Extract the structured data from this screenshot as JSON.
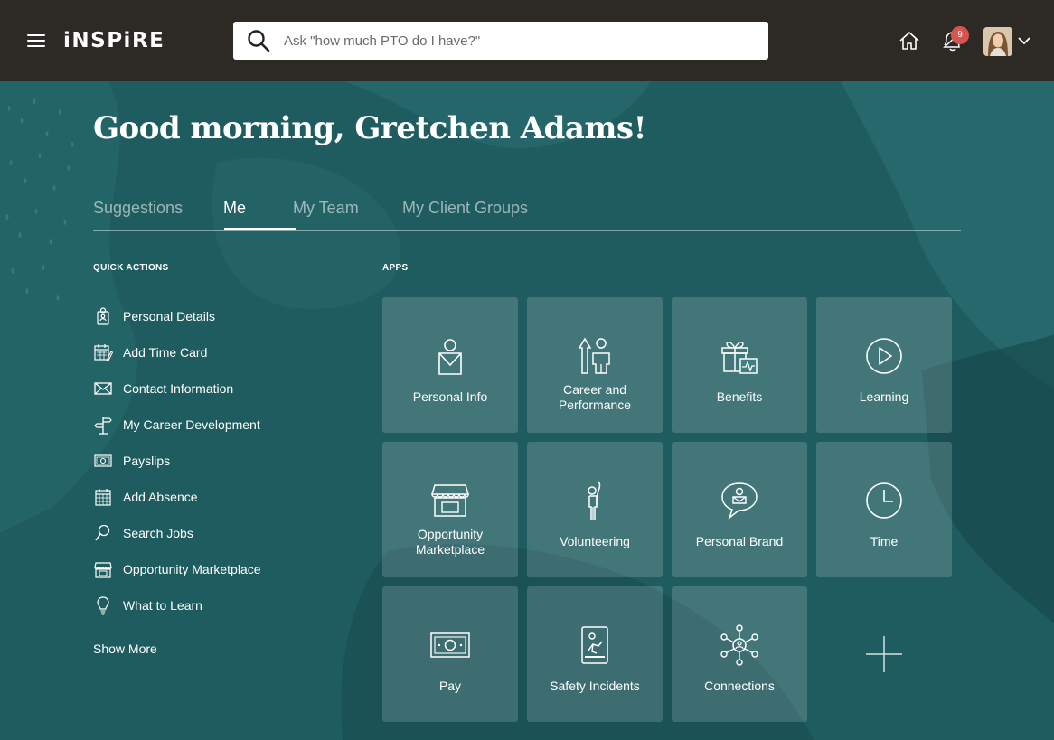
{
  "header": {
    "logo_text": "iNSPiRE",
    "search_placeholder": "Ask \"how much PTO do I have?\"",
    "notification_count": "9",
    "icons": [
      "menu-icon",
      "search-icon",
      "home-icon",
      "notifications-icon",
      "chevron-down-icon"
    ]
  },
  "greeting": "Good morning, Gretchen Adams!",
  "tabs": [
    {
      "label": "Suggestions",
      "active": false
    },
    {
      "label": "Me",
      "active": true
    },
    {
      "label": "My Team",
      "active": false
    },
    {
      "label": "My Client Groups",
      "active": false
    }
  ],
  "quick_actions": {
    "heading": "QUICK ACTIONS",
    "items": [
      {
        "label": "Personal Details",
        "icon": "person-badge-icon"
      },
      {
        "label": "Add Time Card",
        "icon": "time-card-icon"
      },
      {
        "label": "Contact Information",
        "icon": "envelope-icon"
      },
      {
        "label": "My Career Development",
        "icon": "signpost-icon"
      },
      {
        "label": "Payslips",
        "icon": "money-icon"
      },
      {
        "label": "Add Absence",
        "icon": "calendar-icon"
      },
      {
        "label": "Search Jobs",
        "icon": "search-icon"
      },
      {
        "label": "Opportunity Marketplace",
        "icon": "storefront-icon"
      },
      {
        "label": "What to Learn",
        "icon": "lightbulb-icon"
      }
    ],
    "show_more": "Show More"
  },
  "apps": {
    "heading": "APPS",
    "tiles": [
      {
        "label": "Personal Info",
        "icon": "person-badge-icon"
      },
      {
        "label": "Career and Performance",
        "icon": "career-growth-icon"
      },
      {
        "label": "Benefits",
        "icon": "gift-icon"
      },
      {
        "label": "Learning",
        "icon": "play-circle-icon"
      },
      {
        "label": "Opportunity Marketplace",
        "icon": "storefront-icon"
      },
      {
        "label": "Volunteering",
        "icon": "raised-hand-person-icon"
      },
      {
        "label": "Personal Brand",
        "icon": "speech-bubble-person-icon"
      },
      {
        "label": "Time",
        "icon": "clock-icon"
      },
      {
        "label": "Pay",
        "icon": "money-icon"
      },
      {
        "label": "Safety Incidents",
        "icon": "safety-incident-icon"
      },
      {
        "label": "Connections",
        "icon": "network-icon"
      }
    ],
    "add_icon": "plus-icon"
  },
  "colors": {
    "topbar": "#2d2925",
    "background": "#1e5a5e",
    "tile_overlay": "rgba(255,255,255,0.16)",
    "badge": "#d9534f"
  }
}
